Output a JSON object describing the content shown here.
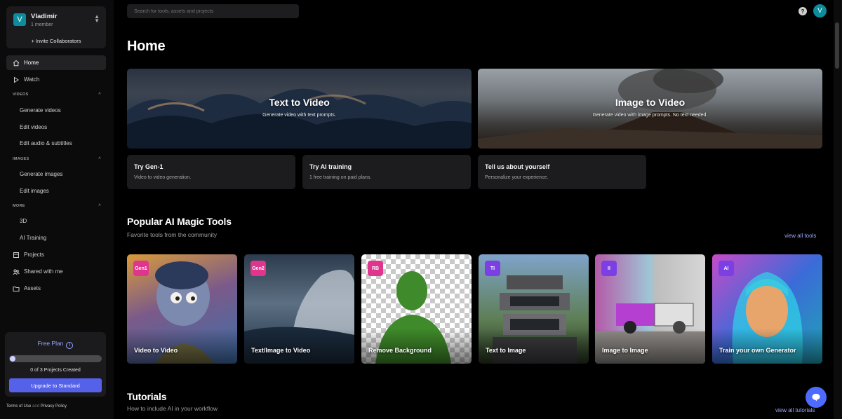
{
  "workspace": {
    "avatar": "V",
    "name": "Vladimir",
    "members": "1 member",
    "invite": "+ Invite Collaborators"
  },
  "nav": {
    "home": "Home",
    "watch": "Watch",
    "videos_section": "VIDEOS",
    "generate_videos": "Generate videos",
    "edit_videos": "Edit videos",
    "edit_audio": "Edit audio & subtitles",
    "images_section": "IMAGES",
    "generate_images": "Generate images",
    "edit_images": "Edit images",
    "more_section": "MORE",
    "three_d": "3D",
    "ai_training": "AI Training",
    "projects": "Projects",
    "shared": "Shared with me",
    "assets": "Assets"
  },
  "plan": {
    "title": "Free Plan",
    "info_icon": "i",
    "count": "0 of 3 Projects Created",
    "progress": 0,
    "upgrade": "Upgrade to Standard"
  },
  "legal": {
    "terms": "Terms of Use",
    "and": "and",
    "privacy": "Privacy Policy"
  },
  "header": {
    "search_placeholder": "Search for tools, assets and projects",
    "help": "?",
    "user_avatar": "V"
  },
  "page": {
    "title": "Home"
  },
  "heroes": [
    {
      "title": "Text to Video",
      "subtitle": "Generate video with text prompts."
    },
    {
      "title": "Image to Video",
      "subtitle": "Generate video with image prompts. No text needed."
    }
  ],
  "quick_cards": [
    {
      "title": "Try Gen-1",
      "subtitle": "Video to video generation."
    },
    {
      "title": "Try AI training",
      "subtitle": "1 free training on paid plans."
    },
    {
      "title": "Tell us about yourself",
      "subtitle": "Personalize your experience."
    }
  ],
  "popular": {
    "title": "Popular AI Magic Tools",
    "subtitle": "Favorite tools from the community",
    "view_all": "view all tools",
    "tools": [
      {
        "badge": "Gen1",
        "label": "Video to Video",
        "badge_color": "#e0358d"
      },
      {
        "badge": "Gen2",
        "label": "Text/Image to Video",
        "badge_color": "#e0358d"
      },
      {
        "badge": "RB",
        "label": "Remove Background",
        "badge_color": "#e0358d"
      },
      {
        "badge": "TI",
        "label": "Text to Image",
        "badge_color": "#7b3fe4"
      },
      {
        "badge": "II",
        "label": "Image to Image",
        "badge_color": "#7b3fe4"
      },
      {
        "badge": "AI",
        "label": "Train your own Generator",
        "badge_color": "#7b3fe4"
      }
    ]
  },
  "tutorials": {
    "title": "Tutorials",
    "subtitle": "How to include AI in your workflow",
    "view_all": "view all tutorials"
  },
  "icons": {
    "home": "home-icon",
    "watch": "play-icon",
    "projects": "projects-icon",
    "shared": "shared-icon",
    "assets": "folder-icon",
    "chat": "chat-icon"
  },
  "colors": {
    "accent": "#5561e8",
    "link": "#9aa7ff",
    "avatar": "#0d8c9c"
  }
}
